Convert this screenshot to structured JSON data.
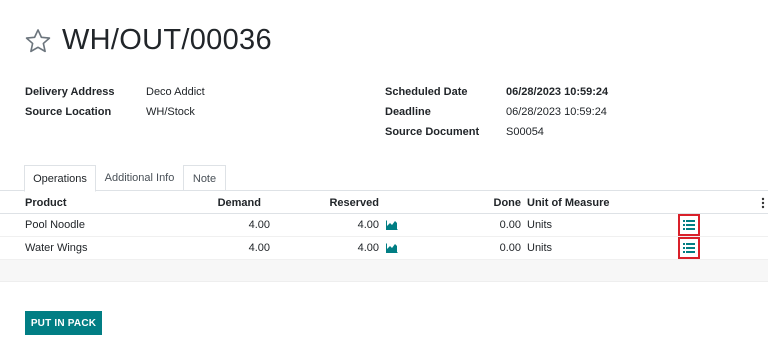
{
  "record": {
    "title": "WH/OUT/00036"
  },
  "fields_left": [
    {
      "label": "Delivery Address",
      "value": "Deco Addict"
    },
    {
      "label": "Source Location",
      "value": "WH/Stock"
    }
  ],
  "fields_right": [
    {
      "label": "Scheduled Date",
      "value": "06/28/2023 10:59:24"
    },
    {
      "label": "Deadline",
      "value": "06/28/2023 10:59:24"
    },
    {
      "label": "Source Document",
      "value": "S00054"
    }
  ],
  "tabs": [
    {
      "label": "Operations",
      "active": true
    },
    {
      "label": "Additional Info",
      "active": false
    },
    {
      "label": "Note",
      "active": false
    }
  ],
  "table": {
    "headers": {
      "product": "Product",
      "demand": "Demand",
      "reserved": "Reserved",
      "done": "Done",
      "uom": "Unit of Measure"
    },
    "rows": [
      {
        "product": "Pool Noodle",
        "demand": "4.00",
        "reserved": "4.00",
        "done": "0.00",
        "uom": "Units"
      },
      {
        "product": "Water Wings",
        "demand": "4.00",
        "reserved": "4.00",
        "done": "0.00",
        "uom": "Units"
      }
    ]
  },
  "actions": {
    "put_in_pack": "PUT IN PACK"
  },
  "colors": {
    "accent": "#017e84",
    "warning": "#e99d00",
    "highlight": "#d9202a"
  },
  "icons": {
    "favorite": "star-icon",
    "forecast": "area-chart-icon",
    "details": "list-icon",
    "optional_columns": "vertical-dots-icon"
  }
}
